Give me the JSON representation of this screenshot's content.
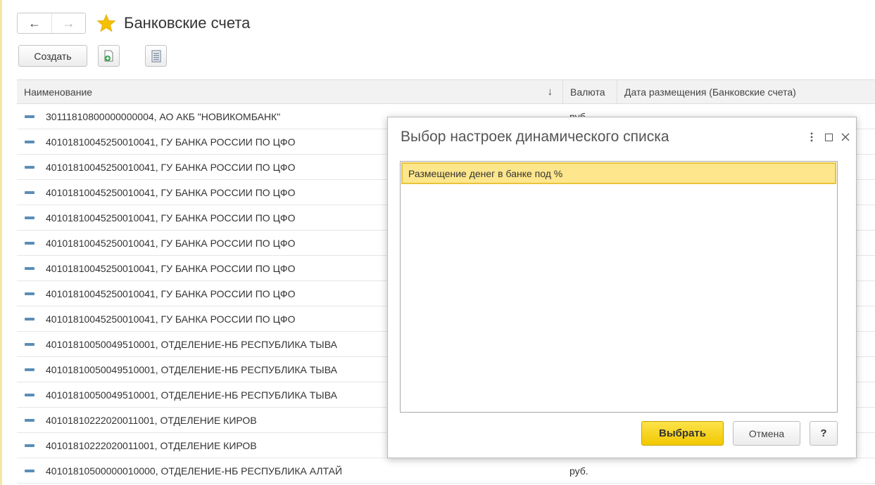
{
  "header": {
    "back_icon": "arrow-left-icon",
    "forward_icon": "arrow-right-icon",
    "favorite_icon": "star-icon",
    "title": "Банковские счета"
  },
  "toolbar": {
    "create_label": "Создать",
    "copy_icon": "add-copy-icon",
    "list_icon": "list-settings-icon"
  },
  "table": {
    "columns": [
      "Наименование",
      "Валюта",
      "Дата размещения (Банковские счета)"
    ],
    "sort_icon": "sort-down-icon",
    "rows": [
      {
        "name": "30111810800000000004, АО АКБ \"НОВИКОМБАНК\"",
        "currency": "руб."
      },
      {
        "name": "40101810045250010041, ГУ БАНКА РОССИИ ПО ЦФО",
        "currency": ""
      },
      {
        "name": "40101810045250010041, ГУ БАНКА РОССИИ ПО ЦФО",
        "currency": ""
      },
      {
        "name": "40101810045250010041, ГУ БАНКА РОССИИ ПО ЦФО",
        "currency": ""
      },
      {
        "name": "40101810045250010041, ГУ БАНКА РОССИИ ПО ЦФО",
        "currency": ""
      },
      {
        "name": "40101810045250010041, ГУ БАНКА РОССИИ ПО ЦФО",
        "currency": ""
      },
      {
        "name": "40101810045250010041, ГУ БАНКА РОССИИ ПО ЦФО",
        "currency": ""
      },
      {
        "name": "40101810045250010041, ГУ БАНКА РОССИИ ПО ЦФО",
        "currency": ""
      },
      {
        "name": "40101810045250010041, ГУ БАНКА РОССИИ ПО ЦФО",
        "currency": ""
      },
      {
        "name": "40101810050049510001, ОТДЕЛЕНИЕ-НБ РЕСПУБЛИКА ТЫВА",
        "currency": ""
      },
      {
        "name": "40101810050049510001, ОТДЕЛЕНИЕ-НБ РЕСПУБЛИКА ТЫВА",
        "currency": ""
      },
      {
        "name": "40101810050049510001, ОТДЕЛЕНИЕ-НБ РЕСПУБЛИКА ТЫВА",
        "currency": ""
      },
      {
        "name": "40101810222020011001, ОТДЕЛЕНИЕ КИРОВ",
        "currency": ""
      },
      {
        "name": "40101810222020011001, ОТДЕЛЕНИЕ КИРОВ",
        "currency": ""
      },
      {
        "name": "40101810500000010000, ОТДЕЛЕНИЕ-НБ РЕСПУБЛИКА АЛТАЙ",
        "currency": "руб."
      }
    ]
  },
  "dialog": {
    "title": "Выбор настроек динамического списка",
    "more_icon": "more-vertical-icon",
    "maximize_icon": "maximize-icon",
    "close_icon": "close-icon",
    "items": [
      "Размещение денег в банке под %"
    ],
    "choose_label": "Выбрать",
    "cancel_label": "Отмена",
    "help_label": "?"
  },
  "colors": {
    "accent": "#f2c800",
    "selection": "#fde68c",
    "row_icon": "#5b8db8"
  }
}
